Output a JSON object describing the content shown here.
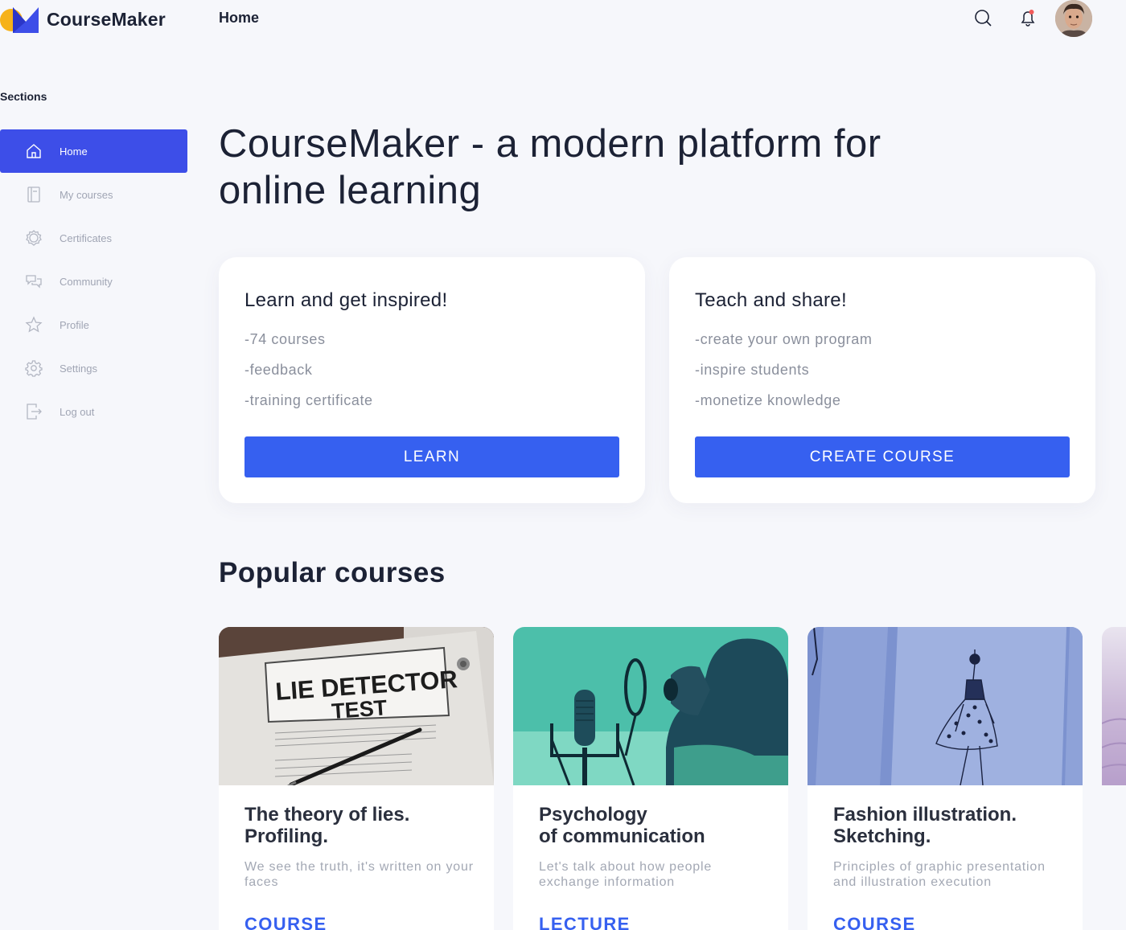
{
  "app": {
    "name": "CourseMaker"
  },
  "header": {
    "title": "Home"
  },
  "sidebar": {
    "title": "Sections",
    "items": [
      {
        "label": "Home",
        "icon": "home-icon",
        "active": true
      },
      {
        "label": "My courses",
        "icon": "book-icon",
        "active": false
      },
      {
        "label": "Certificates",
        "icon": "certificate-icon",
        "active": false
      },
      {
        "label": "Community",
        "icon": "chat-icon",
        "active": false
      },
      {
        "label": "Profile",
        "icon": "star-icon",
        "active": false
      },
      {
        "label": "Settings",
        "icon": "gear-icon",
        "active": false
      },
      {
        "label": "Log out",
        "icon": "logout-icon",
        "active": false
      }
    ]
  },
  "hero": {
    "title": "CourseMaker - a modern platform for online learning"
  },
  "promos": [
    {
      "heading": "Learn and get inspired!",
      "points": [
        "-74 courses",
        "-feedback",
        "-training certificate"
      ],
      "button": "LEARN"
    },
    {
      "heading": "Teach and share!",
      "points": [
        "-create your own program",
        "-inspire students",
        "-monetize knowledge"
      ],
      "button": "CREATE COURSE"
    }
  ],
  "popular": {
    "title": "Popular courses",
    "courses": [
      {
        "image_text_line1": "LIE DETECTOR",
        "image_text_line2": "TEST",
        "title_line1": "The theory of lies.",
        "title_line2": "Profiling.",
        "description": "We see the truth, it's written on your faces",
        "type": "COURSE"
      },
      {
        "title_line1": "Psychology",
        "title_line2": "of communication",
        "description": "Let's talk about how people exchange information",
        "type": "LECTURE"
      },
      {
        "title_line1": "Fashion illustration.",
        "title_line2": "Sketching.",
        "description": "Principles of graphic presentation and illustration execution",
        "type": "COURSE"
      }
    ]
  },
  "colors": {
    "primary": "#3d4ee8",
    "button": "#3660f0",
    "background": "#f6f7fb",
    "logo_yellow": "#f6b21a",
    "notification_dot": "#f15b5b"
  }
}
